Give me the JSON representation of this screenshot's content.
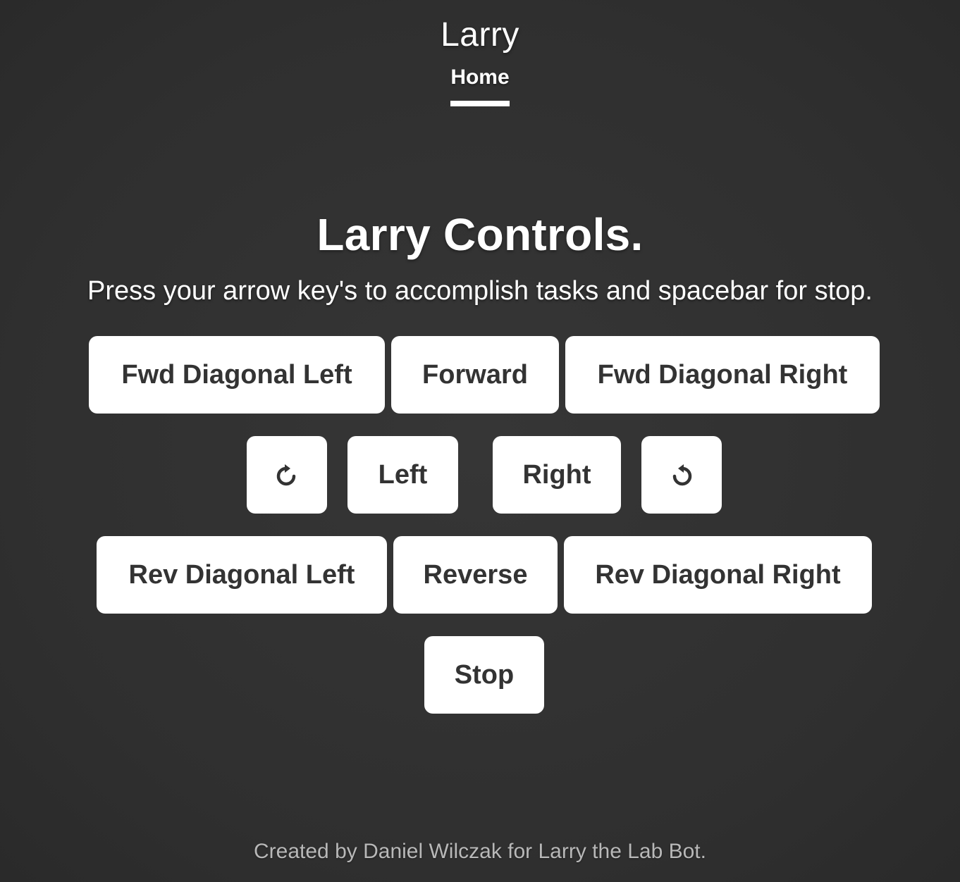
{
  "header": {
    "brand": "Larry",
    "nav": [
      {
        "label": "Home",
        "active": true
      }
    ]
  },
  "main": {
    "heading": "Larry Controls.",
    "lead": "Press your arrow key's to accomplish tasks and spacebar for stop.",
    "controls": {
      "fwd_diagonal_left": "Fwd Diagonal Left",
      "forward": "Forward",
      "fwd_diagonal_right": "Fwd Diagonal Right",
      "rotate_clockwise_icon": "rotate-clockwise-icon",
      "left": "Left",
      "right": "Right",
      "rotate_counterclockwise_icon": "rotate-counterclockwise-icon",
      "rev_diagonal_left": "Rev Diagonal Left",
      "reverse": "Reverse",
      "rev_diagonal_right": "Rev Diagonal Right",
      "stop": "Stop"
    }
  },
  "footer": {
    "text": "Created by Daniel Wilczak for Larry the Lab Bot."
  },
  "colors": {
    "background": "#333333",
    "button_bg": "#ffffff",
    "button_text": "#333333",
    "footer_text": "#b8b8b8"
  }
}
